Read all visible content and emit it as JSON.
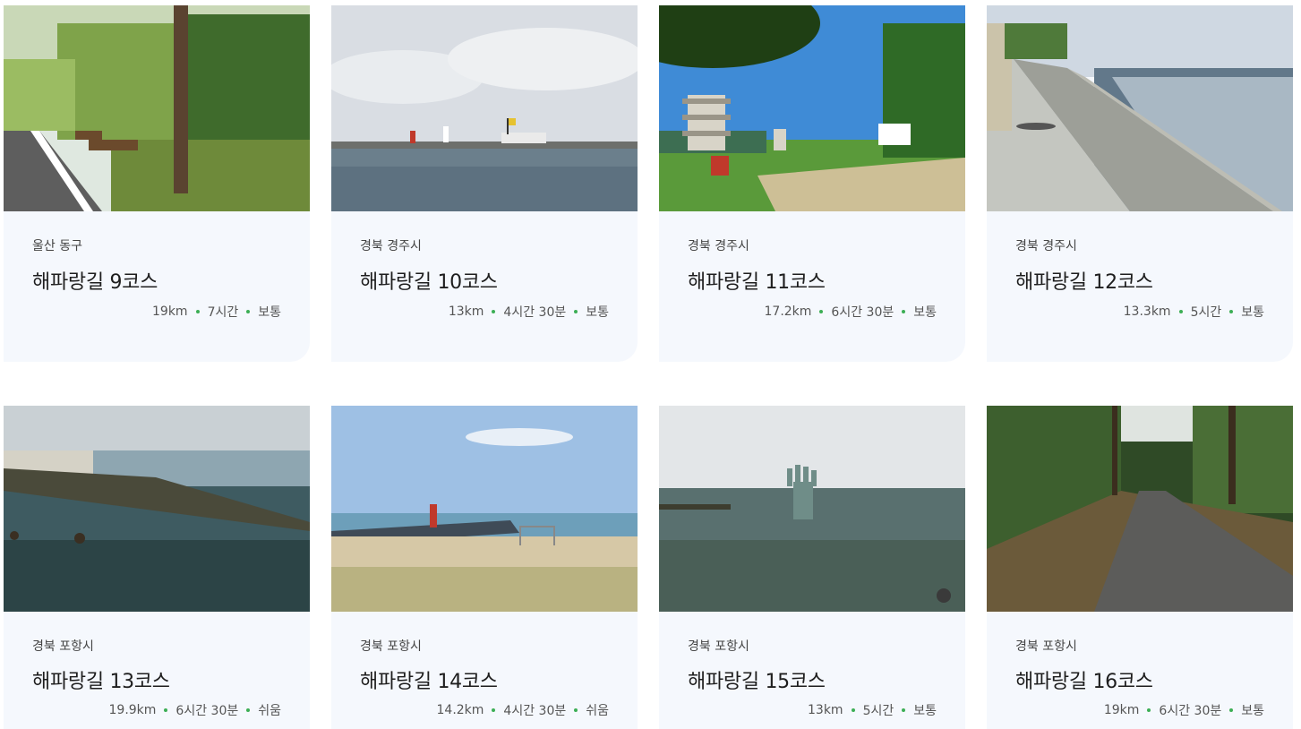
{
  "courses": [
    {
      "region": "울산 동구",
      "title": "해파랑길 9코스",
      "distance": "19km",
      "duration": "7시간",
      "difficulty": "보통"
    },
    {
      "region": "경북 경주시",
      "title": "해파랑길 10코스",
      "distance": "13km",
      "duration": "4시간 30분",
      "difficulty": "보통"
    },
    {
      "region": "경북 경주시",
      "title": "해파랑길 11코스",
      "distance": "17.2km",
      "duration": "6시간 30분",
      "difficulty": "보통"
    },
    {
      "region": "경북 경주시",
      "title": "해파랑길 12코스",
      "distance": "13.3km",
      "duration": "5시간",
      "difficulty": "보통"
    },
    {
      "region": "경북 포항시",
      "title": "해파랑길 13코스",
      "distance": "19.9km",
      "duration": "6시간 30분",
      "difficulty": "쉬움"
    },
    {
      "region": "경북 포항시",
      "title": "해파랑길 14코스",
      "distance": "14.2km",
      "duration": "4시간 30분",
      "difficulty": "쉬움"
    },
    {
      "region": "경북 포항시",
      "title": "해파랑길 15코스",
      "distance": "13km",
      "duration": "5시간",
      "difficulty": "보통"
    },
    {
      "region": "경북 포항시",
      "title": "해파랑길 16코스",
      "distance": "19km",
      "duration": "6시간 30분",
      "difficulty": "보통"
    }
  ],
  "colors": {
    "card_bg": "#f5f8fd",
    "dot": "#3cae55"
  }
}
